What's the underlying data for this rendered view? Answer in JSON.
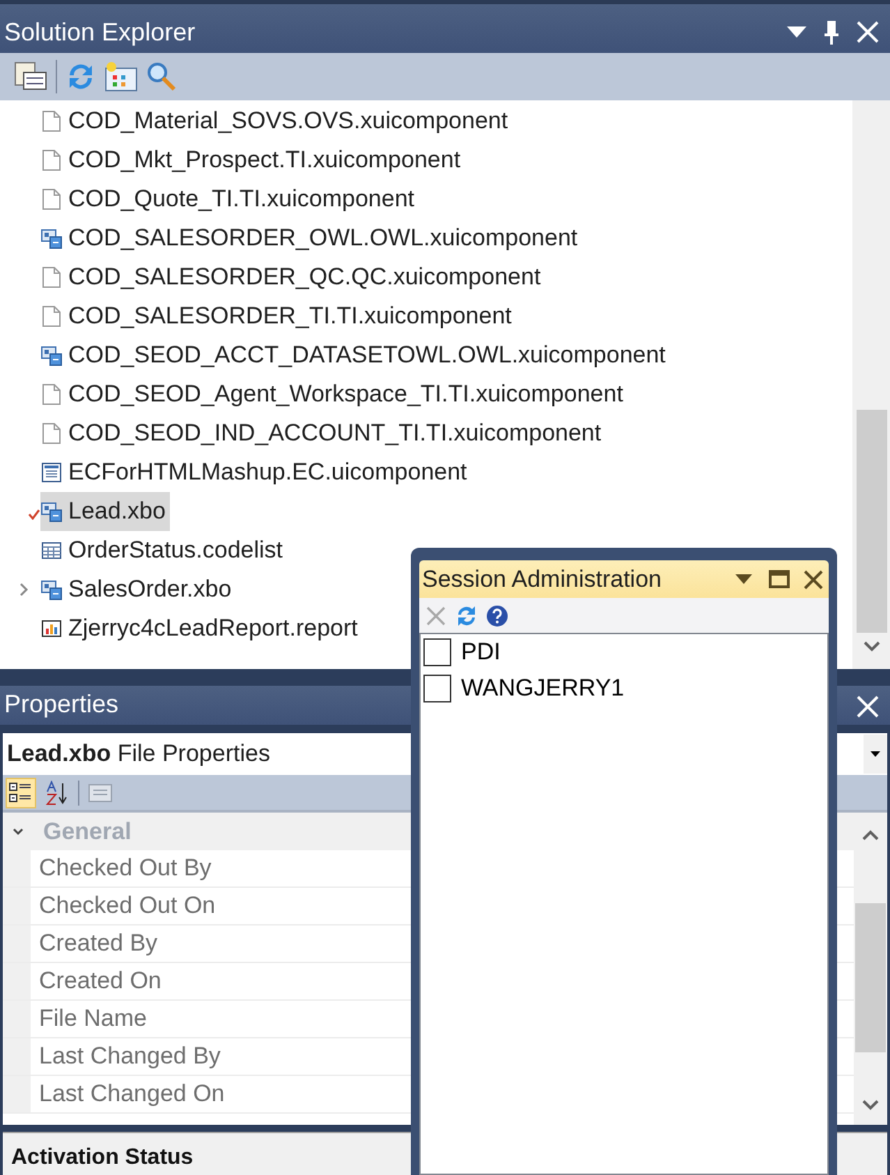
{
  "solution_explorer": {
    "title": "Solution Explorer",
    "items": [
      {
        "label": "COD_Material_SOVS.OVS.xuicomponent",
        "kind": "document",
        "selected": false,
        "checked_out": false
      },
      {
        "label": "COD_Mkt_Prospect.TI.xuicomponent",
        "kind": "document",
        "selected": false,
        "checked_out": false
      },
      {
        "label": "COD_Quote_TI.TI.xuicomponent",
        "kind": "document",
        "selected": false,
        "checked_out": false
      },
      {
        "label": "COD_SALESORDER_OWL.OWL.xuicomponent",
        "kind": "component",
        "selected": false,
        "checked_out": false
      },
      {
        "label": "COD_SALESORDER_QC.QC.xuicomponent",
        "kind": "document",
        "selected": false,
        "checked_out": false
      },
      {
        "label": "COD_SALESORDER_TI.TI.xuicomponent",
        "kind": "document",
        "selected": false,
        "checked_out": false
      },
      {
        "label": "COD_SEOD_ACCT_DATASETOWL.OWL.xuicomponent",
        "kind": "component",
        "selected": false,
        "checked_out": false
      },
      {
        "label": "COD_SEOD_Agent_Workspace_TI.TI.xuicomponent",
        "kind": "document",
        "selected": false,
        "checked_out": false
      },
      {
        "label": "COD_SEOD_IND_ACCOUNT_TI.TI.xuicomponent",
        "kind": "document",
        "selected": false,
        "checked_out": false
      },
      {
        "label": "ECForHTMLMashup.EC.uicomponent",
        "kind": "form",
        "selected": false,
        "checked_out": false
      },
      {
        "label": "Lead.xbo",
        "kind": "component",
        "selected": true,
        "checked_out": true
      },
      {
        "label": "OrderStatus.codelist",
        "kind": "table",
        "selected": false,
        "checked_out": false
      },
      {
        "label": "SalesOrder.xbo",
        "kind": "component",
        "selected": false,
        "checked_out": false,
        "expanded": false
      },
      {
        "label": "Zjerryc4cLeadReport.report",
        "kind": "chart",
        "selected": false,
        "checked_out": false
      }
    ]
  },
  "properties": {
    "title": "Properties",
    "object": "**Lead.xbo** File Properties",
    "view_buttons": [
      {
        "kind": "categorized",
        "selected": true
      },
      {
        "kind": "alphabetical",
        "selected": false
      }
    ],
    "property_pages": {
      "disabled": true
    },
    "category": {
      "name": "General",
      "expanded": true,
      "rows": [
        "Checked Out By",
        "Checked Out On",
        "Created By",
        "Created On",
        "File Name",
        "Last Changed By",
        "Last Changed On"
      ]
    },
    "description_title": "Activation Status"
  },
  "session_administration": {
    "title": "Session Administration",
    "buttons": [
      {
        "kind": "delete",
        "disabled": true
      },
      {
        "kind": "refresh",
        "disabled": false
      },
      {
        "kind": "help",
        "disabled": false
      }
    ],
    "sessions": [
      {
        "label": "PDI",
        "checked": false
      },
      {
        "label": "WANGJERRY1",
        "checked": false
      }
    ]
  }
}
